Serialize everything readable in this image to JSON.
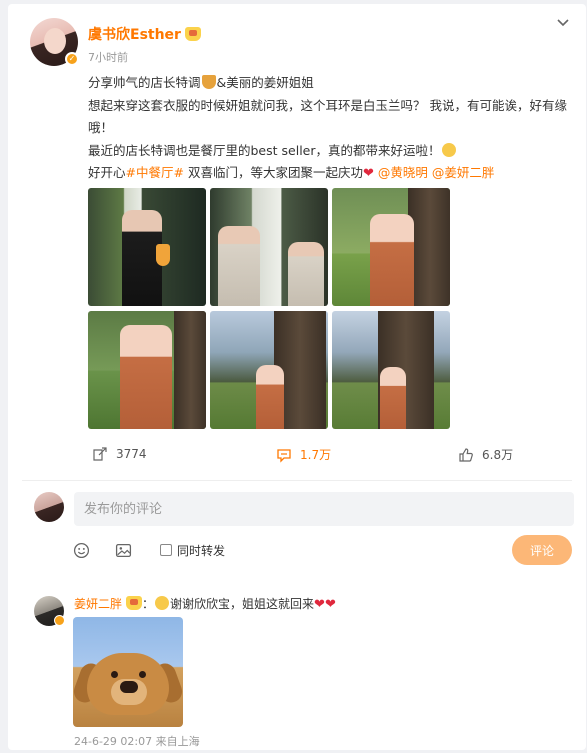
{
  "post": {
    "author_name": "虞书欣Esther",
    "time": "7小时前",
    "line1_a": "分享帅气的店长特调",
    "line1_b": "&美丽的姜妍姐姐",
    "line2": "想起来穿这套衣服的时候妍姐就问我，这个耳环是白玉兰吗？ 我说，有可能诶，好有缘哦！",
    "line3": "最近的店长特调也是餐厅里的best seller，真的都带来好运啦！",
    "line4_a": "好开心",
    "hashtag": "#中餐厅#",
    "line4_b": " 双喜临门，等大家团聚一起庆功",
    "mention1": "@黄晓明",
    "mention2": "@姜妍二胖"
  },
  "actions": {
    "repost_count": "3774",
    "comment_count": "1.7万",
    "like_count": "6.8万"
  },
  "composer": {
    "placeholder": "发布你的评论",
    "repost_label": "同时转发",
    "submit_label": "评论"
  },
  "comment": {
    "author": "姜妍二胖",
    "text": "谢谢欣欣宝，姐姐这就回来",
    "meta": "24-6-29 02:07 来自上海"
  },
  "colors": {
    "accent": "#ff7800",
    "heart": "#e0283d",
    "submit_bg": "#fcb777"
  },
  "icons": [
    "chevron-down-icon",
    "repost-icon",
    "comment-icon",
    "like-icon",
    "emoji-icon",
    "image-icon",
    "verified-badge-icon"
  ]
}
